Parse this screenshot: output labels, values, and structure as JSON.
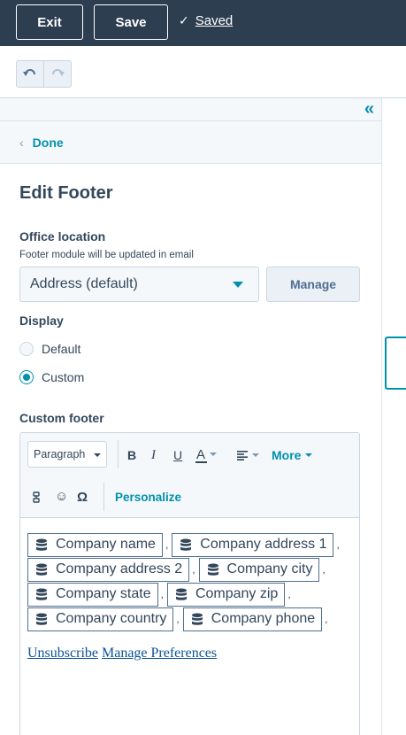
{
  "topbar": {
    "exit_label": "Exit",
    "save_label": "Save",
    "saved_label": "Saved"
  },
  "panel": {
    "done_label": "Done",
    "title": "Edit Footer",
    "office_label": "Office location",
    "office_help": "Footer module will be updated in email",
    "office_value": "Address (default)",
    "manage_label": "Manage",
    "display_label": "Display",
    "display_options": [
      "Default",
      "Custom"
    ],
    "display_selected": "Custom",
    "custom_footer_label": "Custom footer"
  },
  "toolbar": {
    "paragraph": "Paragraph",
    "bold": "B",
    "italic": "I",
    "underline": "U",
    "text_color": "A",
    "more_label": "More",
    "omega": "Ω",
    "personalize_label": "Personalize"
  },
  "footer_tokens": [
    [
      "Company name",
      "Company address 1"
    ],
    [
      "Company address 2",
      "Company city"
    ],
    [
      "Company state",
      "Company zip"
    ],
    [
      "Company country",
      "Company phone"
    ]
  ],
  "links": {
    "unsubscribe": "Unsubscribe",
    "manage_preferences": "Manage Preferences"
  },
  "colors": {
    "topbar": "#2d3e50",
    "accent": "#0091ae",
    "text": "#33475b",
    "border": "#cbd6e2"
  }
}
